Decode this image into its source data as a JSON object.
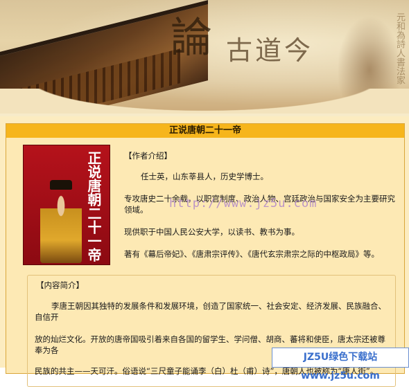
{
  "banner": {
    "calligraphy": "論",
    "brand": "古道今",
    "scroll_text": "元和為詩人書法家"
  },
  "book": {
    "title": "正说唐朝二十一帝",
    "cover_title": "正说唐朝二十一帝"
  },
  "author": {
    "heading": "【作者介绍】",
    "p1": "任士英，山东莘县人，历史学博士。",
    "p2": "专攻唐史二十余载，以职官制度、政治人物、宫廷政治与国家安全为主要研究领域。",
    "p3": "现供职于中国人民公安大学，以读书、教书为事。",
    "p4": "著有《幕后帝妃》、《唐肃宗评传》、《唐代玄宗肃宗之际的中枢政局》等。"
  },
  "watermark": {
    "url": "http://www.jz5u.com"
  },
  "summary": {
    "heading": "【内容简介】",
    "p1": "李唐王朝因其独特的发展条件和发展环境，创造了国家统一、社会安定、经济发展、民族融合、自信开",
    "p2": "放的灿烂文化。开放的唐帝国吸引着来自各国的留学生、学问僧、胡商、蕃将和使臣，唐太宗还被尊奉为各",
    "p3": "民族的共主——天可汗。俗语说“三尺童子能诵李（白）杜（甫）诗”，唐朝人也被称为“唐人街”。"
  },
  "download_badge": {
    "label": "JZ5U绿色下载站www.jz5u.com"
  }
}
